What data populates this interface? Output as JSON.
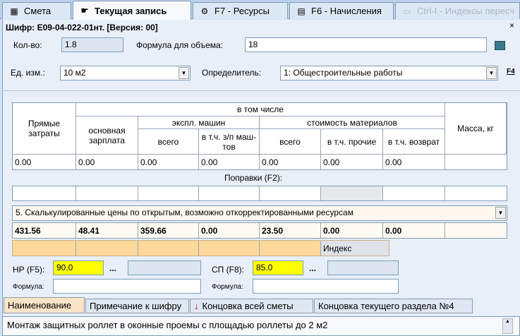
{
  "tabs": [
    {
      "label": "Смета",
      "icon": "table-icon"
    },
    {
      "label": "Текущая запись",
      "icon": "hand-pointer-icon"
    },
    {
      "label": "F7 - Ресурсы",
      "icon": "gear-icon"
    },
    {
      "label": "F6 - Начисления",
      "icon": "calculator-icon"
    },
    {
      "label": "Ctrl-I - Индексы пересч",
      "icon": "document-icon"
    }
  ],
  "record": {
    "header": "Шифр: Е09-04-022-01нт.  [Версия:    00]",
    "qty_label": "Кол-во:",
    "qty_value": "1.8",
    "formula_label": "Формула для объема:",
    "formula_value": "18",
    "unit_label": "Ед. изм.:",
    "unit_value": "10 м2",
    "determiner_label": "Определитель:",
    "determiner_value": "1: Общестроительные работы",
    "f4_label": "F4"
  },
  "grid": {
    "headers": {
      "direct": "Прямые затраты",
      "including": "в том числе",
      "base_salary": "основная зарплата",
      "machines": "экспл. машин",
      "machines_total": "всего",
      "machines_incl": "в т.ч. з/п маш-тов",
      "materials": "стоимость материалов",
      "materials_total": "всего",
      "materials_other": "в т.ч. прочие",
      "materials_return": "в т.ч. возврат",
      "mass": "Масса, кг"
    },
    "values": [
      "0.00",
      "0.00",
      "0.00",
      "0.00",
      "0.00",
      "0.00",
      "0.00",
      ""
    ]
  },
  "corrections_label": "Поправки (F2):",
  "price_mode": "5. Скалькулированные цены по открытым, возможно откорректированными ресурсам",
  "calculated": [
    "431.56",
    "48.41",
    "359.66",
    "0.00",
    "23.50",
    "0.00",
    "0.00",
    ""
  ],
  "index_label": "Индекс",
  "nr": {
    "label": "НР (F5):",
    "value": "90.0",
    "dots": "...",
    "formula_label": "Формула:"
  },
  "sp": {
    "label": "СП (F8):",
    "value": "85.0",
    "dots": "...",
    "formula_label": "Формула:"
  },
  "bottom_tabs": [
    "Наименование",
    "Примечание к шифру",
    "Концовка всей сметы",
    "Концовка текущего раздела №4"
  ],
  "description": "Монтаж защитных роллет в оконные проемы с площадью роллеты до 2 м2"
}
